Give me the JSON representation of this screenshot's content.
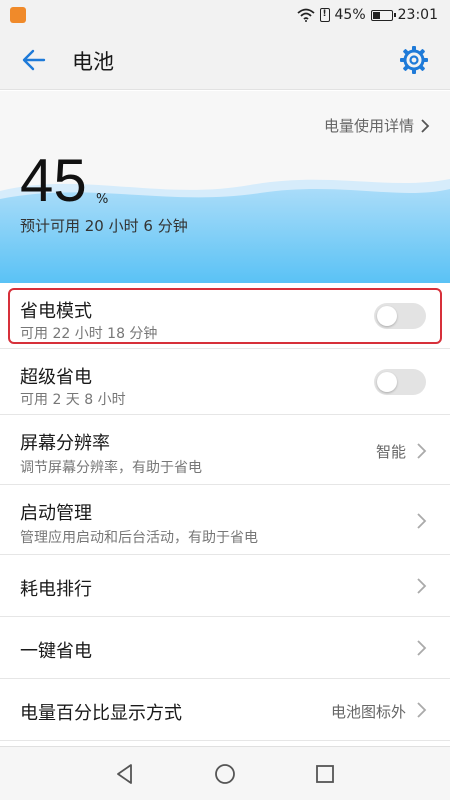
{
  "status_bar": {
    "battery_percent_label": "45%",
    "battery_level": 0.45,
    "time": "23:01",
    "icons": [
      "app-notification-icon",
      "wifi-icon",
      "alert-icon",
      "battery-icon"
    ]
  },
  "app_bar": {
    "title": "电池",
    "icons": [
      "back-arrow-icon",
      "gear-icon"
    ],
    "accent": "#1e7ad8"
  },
  "hero": {
    "usage_details_link": "电量使用详情",
    "battery_percent": "45",
    "percent_sign": "%",
    "estimate": "预计可用 20 小时 6 分钟",
    "wave_colors": [
      "#cfe9fb",
      "#8fd0f8",
      "#5ac2f5"
    ]
  },
  "list": {
    "power_saving": {
      "title": "省电模式",
      "subtitle": "可用 22 小时 18 分钟",
      "enabled": false,
      "highlighted": true,
      "highlight_color": "#d7303a"
    },
    "ultra_saving": {
      "title": "超级省电",
      "subtitle": "可用 2 天 8 小时",
      "enabled": false
    },
    "resolution": {
      "title": "屏幕分辨率",
      "subtitle": "调节屏幕分辨率，有助于省电",
      "value": "智能"
    },
    "startup": {
      "title": "启动管理",
      "subtitle": "管理应用启动和后台活动，有助于省电"
    },
    "ranking": {
      "title": "耗电排行"
    },
    "one_tap": {
      "title": "一键省电"
    },
    "percent_display": {
      "title": "电量百分比显示方式",
      "value": "电池图标外"
    }
  },
  "nav_bar": {
    "icons": [
      "back-triangle-icon",
      "home-circle-icon",
      "recents-square-icon"
    ]
  }
}
